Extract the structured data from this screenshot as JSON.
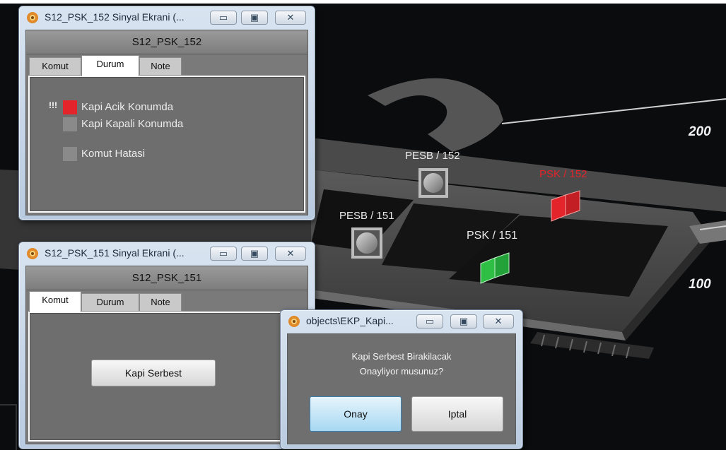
{
  "scene": {
    "labels": {
      "pesb_152": "PESB / 152",
      "psk_152": "PSK / 152",
      "pesb_151": "PESB / 151",
      "psk_151": "PSK / 151",
      "marker_200": "200",
      "marker_100": "100"
    },
    "colors": {
      "door_open": "#e3242b",
      "door_closed": "#2fbf45"
    }
  },
  "win152": {
    "title": "S12_PSK_152 Sinyal Ekrani (...",
    "header": "S12_PSK_152",
    "tabs": [
      "Komut",
      "Durum",
      "Note"
    ],
    "active_tab": "Durum",
    "alert_mark": "!!!",
    "indicators": [
      {
        "label": "Kapi Acik Konumda",
        "state": "red"
      },
      {
        "label": "Kapi Kapali Konumda",
        "state": "grey"
      },
      {
        "label": "Komut Hatasi",
        "state": "grey"
      }
    ]
  },
  "win151": {
    "title": "S12_PSK_151 Sinyal Ekrani (...",
    "header": "S12_PSK_151",
    "tabs": [
      "Komut",
      "Durum",
      "Note"
    ],
    "active_tab": "Komut",
    "button": "Kapi Serbest"
  },
  "dialog": {
    "title": "objects\\EKP_Kapi...",
    "message_line1": "Kapi Serbest Birakilacak",
    "message_line2": "Onayliyor musunuz?",
    "ok": "Onay",
    "cancel": "Iptal"
  },
  "window_controls": {
    "minimize": "▭",
    "maximize": "▣",
    "close": "✕"
  }
}
